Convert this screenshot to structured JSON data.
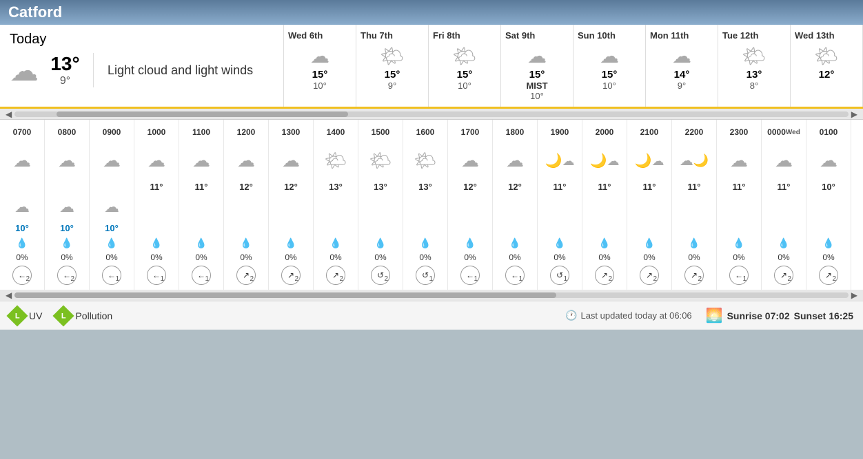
{
  "header": {
    "city": "Catford"
  },
  "today": {
    "label": "Today",
    "high": "13°",
    "low": "9°",
    "description": "Light cloud and light winds",
    "icon": "cloud"
  },
  "forecast_days": [
    {
      "name": "Wed 6th",
      "high": "15°",
      "low": "10°",
      "icon": "cloud",
      "mist": ""
    },
    {
      "name": "Thu 7th",
      "high": "15°",
      "low": "9°",
      "icon": "partly-sun",
      "mist": ""
    },
    {
      "name": "Fri 8th",
      "high": "15°",
      "low": "10°",
      "icon": "partly-sun",
      "mist": ""
    },
    {
      "name": "Sat 9th",
      "high": "15°",
      "low": "10°",
      "icon": "cloud",
      "mist": "MIST"
    },
    {
      "name": "Sun 10th",
      "high": "15°",
      "low": "10°",
      "icon": "cloud",
      "mist": ""
    },
    {
      "name": "Mon 11th",
      "high": "14°",
      "low": "9°",
      "icon": "cloud",
      "mist": ""
    },
    {
      "name": "Tue 12th",
      "high": "13°",
      "low": "8°",
      "icon": "partly-sun",
      "mist": ""
    },
    {
      "name": "Wed 13th",
      "high": "12°",
      "low": "",
      "icon": "partly-sun",
      "mist": ""
    }
  ],
  "hours": [
    {
      "label": "0700",
      "sub": "",
      "icon": "cloud",
      "high": "",
      "icon2": "cloud-sm",
      "low": "10°",
      "rain_pct": "0%",
      "wind_dir": "←",
      "wind_spd": "2"
    },
    {
      "label": "0800",
      "sub": "",
      "icon": "cloud",
      "high": "",
      "icon2": "cloud-sm",
      "low": "10°",
      "rain_pct": "0%",
      "wind_dir": "←",
      "wind_spd": "2"
    },
    {
      "label": "0900",
      "sub": "",
      "icon": "cloud",
      "high": "",
      "icon2": "cloud-sm",
      "low": "10°",
      "rain_pct": "0%",
      "wind_dir": "←",
      "wind_spd": "1"
    },
    {
      "label": "1000",
      "sub": "",
      "icon": "cloud",
      "high": "11°",
      "icon2": "cloud-sm",
      "low": "",
      "rain_pct": "0%",
      "wind_dir": "←",
      "wind_spd": "1"
    },
    {
      "label": "1100",
      "sub": "",
      "icon": "cloud",
      "high": "11°",
      "icon2": "cloud-sm",
      "low": "",
      "rain_pct": "0%",
      "wind_dir": "←",
      "wind_spd": "1"
    },
    {
      "label": "1200",
      "sub": "",
      "icon": "cloud",
      "high": "12°",
      "icon2": "",
      "low": "",
      "rain_pct": "0%",
      "wind_dir": "↗",
      "wind_spd": "2"
    },
    {
      "label": "1300",
      "sub": "",
      "icon": "cloud",
      "high": "12°",
      "icon2": "",
      "low": "",
      "rain_pct": "0%",
      "wind_dir": "↗",
      "wind_spd": "2"
    },
    {
      "label": "1400",
      "sub": "",
      "icon": "partly-sun",
      "high": "13°",
      "icon2": "",
      "low": "",
      "rain_pct": "0%",
      "wind_dir": "↗",
      "wind_spd": "2"
    },
    {
      "label": "1500",
      "sub": "",
      "icon": "partly-sun",
      "high": "13°",
      "icon2": "",
      "low": "",
      "rain_pct": "0%",
      "wind_dir": "↺",
      "wind_spd": "2"
    },
    {
      "label": "1600",
      "sub": "",
      "icon": "partly-sun",
      "high": "13°",
      "icon2": "",
      "low": "",
      "rain_pct": "0%",
      "wind_dir": "↺",
      "wind_spd": "1"
    },
    {
      "label": "1700",
      "sub": "",
      "icon": "cloud",
      "high": "12°",
      "icon2": "",
      "low": "",
      "rain_pct": "0%",
      "wind_dir": "←",
      "wind_spd": "1"
    },
    {
      "label": "1800",
      "sub": "",
      "icon": "cloud",
      "high": "12°",
      "icon2": "",
      "low": "",
      "rain_pct": "0%",
      "wind_dir": "←",
      "wind_spd": "1"
    },
    {
      "label": "1900",
      "sub": "",
      "icon": "night-cloud",
      "high": "11°",
      "icon2": "",
      "low": "",
      "rain_pct": "0%",
      "wind_dir": "↺",
      "wind_spd": "1"
    },
    {
      "label": "2000",
      "sub": "",
      "icon": "night-cloud",
      "high": "11°",
      "icon2": "",
      "low": "",
      "rain_pct": "0%",
      "wind_dir": "↗",
      "wind_spd": "2"
    },
    {
      "label": "2100",
      "sub": "",
      "icon": "night-cloud",
      "high": "11°",
      "icon2": "",
      "low": "",
      "rain_pct": "0%",
      "wind_dir": "↗",
      "wind_spd": "2"
    },
    {
      "label": "2200",
      "sub": "",
      "icon": "cloud-night",
      "high": "11°",
      "icon2": "",
      "low": "",
      "rain_pct": "0%",
      "wind_dir": "↗",
      "wind_spd": "2"
    },
    {
      "label": "2300",
      "sub": "",
      "icon": "cloud",
      "high": "11°",
      "icon2": "",
      "low": "",
      "rain_pct": "0%",
      "wind_dir": "←",
      "wind_spd": "1"
    },
    {
      "label": "0000",
      "sub": "Wed",
      "icon": "cloud",
      "high": "11°",
      "icon2": "",
      "low": "",
      "rain_pct": "0%",
      "wind_dir": "↗",
      "wind_spd": "2"
    },
    {
      "label": "0100",
      "sub": "",
      "icon": "cloud",
      "high": "10°",
      "icon2": "",
      "low": "",
      "rain_pct": "0%",
      "wind_dir": "↗",
      "wind_spd": "2"
    }
  ],
  "footer": {
    "uv_label": "UV",
    "uv_level": "L",
    "pollution_label": "Pollution",
    "pollution_level": "L",
    "last_updated": "Last updated today at 06:06",
    "sunrise": "Sunrise 07:02",
    "sunset": "Sunset 16:25"
  }
}
